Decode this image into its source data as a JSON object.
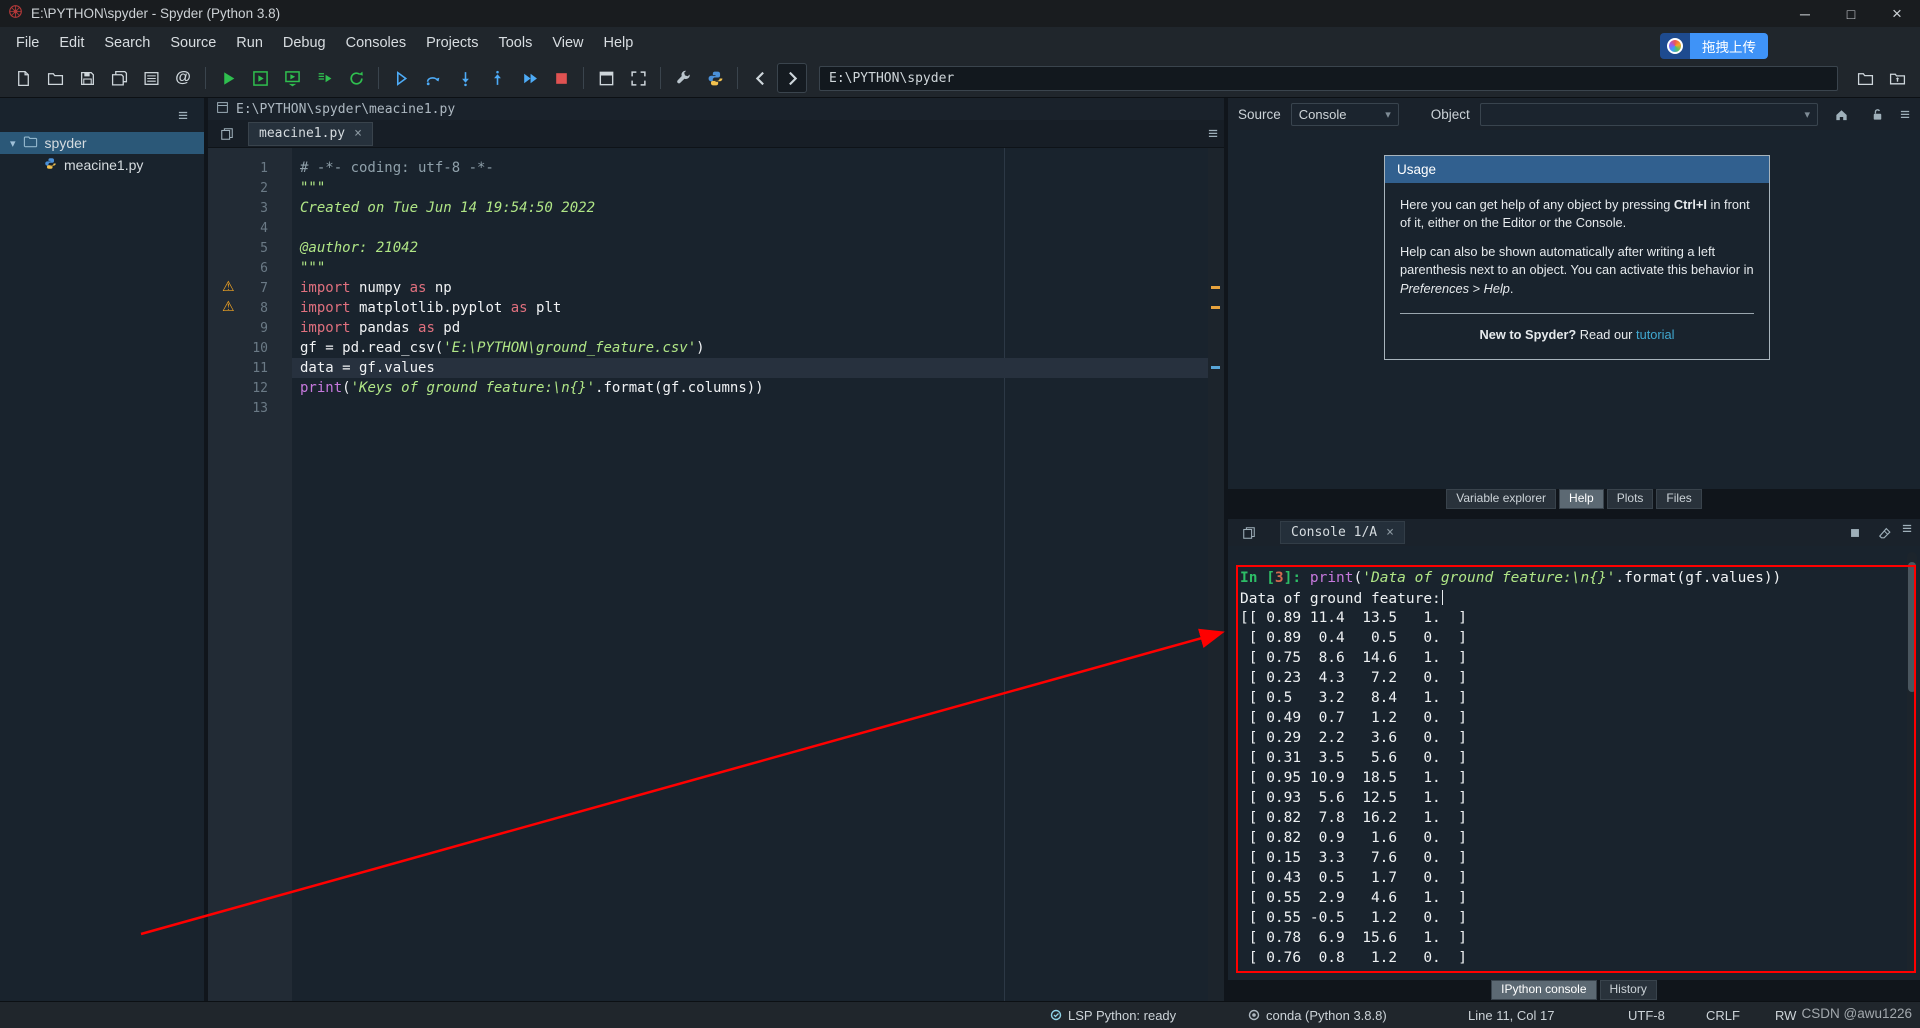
{
  "icons": {
    "hamburger": "≡",
    "close": "×",
    "dropdown_arrow": "▾",
    "caret_down": "▾",
    "warning": "⚠",
    "minimize": "─",
    "maximize": "□",
    "at": "@"
  },
  "window": {
    "title": "E:\\PYTHON\\spyder - Spyder (Python 3.8)"
  },
  "menu": {
    "items": [
      "File",
      "Edit",
      "Search",
      "Source",
      "Run",
      "Debug",
      "Consoles",
      "Projects",
      "Tools",
      "View",
      "Help"
    ]
  },
  "overlay": {
    "upload_badge": "拖拽上传",
    "watermark": "CSDN @awu1226"
  },
  "toolbar": {
    "path_value": "E:\\PYTHON\\spyder"
  },
  "project": {
    "root_label": "spyder",
    "file_label": "meacine1.py"
  },
  "editor": {
    "path_header": "E:\\PYTHON\\spyder\\meacine1.py",
    "tab_label": "meacine1.py",
    "current_line": 11,
    "warning_lines": [
      7,
      8
    ],
    "lines": [
      [
        {
          "t": "# -*- coding: utf-8 -*-",
          "c": "comment"
        }
      ],
      [
        {
          "t": "\"\"\"",
          "c": "string"
        }
      ],
      [
        {
          "t": "Created on Tue Jun 14 19:54:50 2022",
          "c": "string"
        }
      ],
      [],
      [
        {
          "t": "@author: 21042",
          "c": "string"
        }
      ],
      [
        {
          "t": "\"\"\"",
          "c": "string"
        }
      ],
      [
        {
          "t": "import",
          "c": "keyword"
        },
        {
          "t": " numpy ",
          "c": "normal"
        },
        {
          "t": "as",
          "c": "keyword"
        },
        {
          "t": " np",
          "c": "normal"
        }
      ],
      [
        {
          "t": "import",
          "c": "keyword"
        },
        {
          "t": " matplotlib.pyplot ",
          "c": "normal"
        },
        {
          "t": "as",
          "c": "keyword"
        },
        {
          "t": " plt",
          "c": "normal"
        }
      ],
      [
        {
          "t": "import",
          "c": "keyword"
        },
        {
          "t": " pandas ",
          "c": "normal"
        },
        {
          "t": "as",
          "c": "keyword"
        },
        {
          "t": " pd",
          "c": "normal"
        }
      ],
      [
        {
          "t": "gf = pd.read_csv(",
          "c": "normal"
        },
        {
          "t": "'E:\\PYTHON\\ground_feature.csv'",
          "c": "string"
        },
        {
          "t": ")",
          "c": "normal"
        }
      ],
      [
        {
          "t": "data = gf.values",
          "c": "normal"
        }
      ],
      [
        {
          "t": "print",
          "c": "builtin"
        },
        {
          "t": "(",
          "c": "normal"
        },
        {
          "t": "'Keys of ground feature:\\n{}'",
          "c": "string"
        },
        {
          "t": ".format(gf.columns))",
          "c": "normal"
        }
      ],
      []
    ]
  },
  "help": {
    "source_label": "Source",
    "source_value": "Console",
    "object_label": "Object",
    "usage_title": "Usage",
    "p1_pre": "Here you can get help of any object by pressing ",
    "p1_kbd": "Ctrl+I",
    "p1_post": " in front of it, either on the Editor or the Console.",
    "p2_pre": "Help can also be shown automatically after writing a left parenthesis next to an object. You can activate this behavior in ",
    "p2_em": "Preferences > Help",
    "p2_post": ".",
    "footer_q": "New to Spyder?",
    "footer_mid": " Read our ",
    "footer_link": "tutorial",
    "tabs": [
      "Variable explorer",
      "Help",
      "Plots",
      "Files"
    ],
    "active_tab": "Help"
  },
  "console": {
    "tab_label": "Console 1/A",
    "prompt_segments": [
      {
        "t": "In [",
        "c": "prompt"
      },
      {
        "t": "3",
        "c": "prompt-num"
      },
      {
        "t": "]: ",
        "c": "prompt"
      },
      {
        "t": "print",
        "c": "builtin"
      },
      {
        "t": "(",
        "c": "normal"
      },
      {
        "t": "'Data of ground feature:\\n{}'",
        "c": "string"
      },
      {
        "t": ".format(gf.values))",
        "c": "normal"
      }
    ],
    "echo_line": "Data of ground feature:",
    "matrix_rows": [
      "[[ 0.89 11.4  13.5   1.  ]",
      " [ 0.89  0.4   0.5   0.  ]",
      " [ 0.75  8.6  14.6   1.  ]",
      " [ 0.23  4.3   7.2   0.  ]",
      " [ 0.5   3.2   8.4   1.  ]",
      " [ 0.49  0.7   1.2   0.  ]",
      " [ 0.29  2.2   3.6   0.  ]",
      " [ 0.31  3.5   5.6   0.  ]",
      " [ 0.95 10.9  18.5   1.  ]",
      " [ 0.93  5.6  12.5   1.  ]",
      " [ 0.82  7.8  16.2   1.  ]",
      " [ 0.82  0.9   1.6   0.  ]",
      " [ 0.15  3.3   7.6   0.  ]",
      " [ 0.43  0.5   1.7   0.  ]",
      " [ 0.55  2.9   4.6   1.  ]",
      " [ 0.55 -0.5   1.2   0.  ]",
      " [ 0.78  6.9  15.6   1.  ]",
      " [ 0.76  0.8   1.2   0.  ]"
    ],
    "bottom_tabs": [
      "IPython console",
      "History"
    ]
  },
  "statusbar": {
    "lsp": "LSP Python: ready",
    "interpreter": "conda (Python 3.8.8)",
    "cursor": "Line 11, Col 17",
    "encoding": "UTF-8",
    "eol": "CRLF",
    "permissions": "RW"
  }
}
